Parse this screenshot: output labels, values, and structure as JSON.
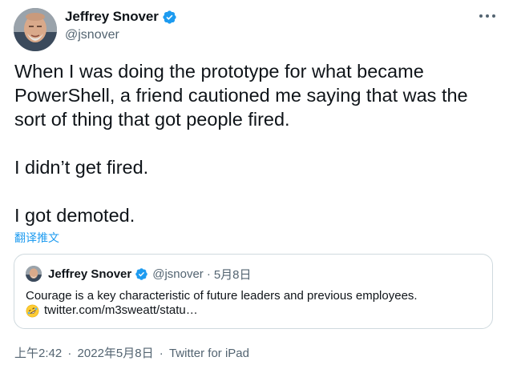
{
  "author": {
    "display_name": "Jeffrey Snover",
    "handle": "@jsnover",
    "verified": true
  },
  "tweet": {
    "paragraphs": [
      "When I was doing the prototype for what became PowerShell, a friend cautioned me saying that was the sort of thing that got people fired.",
      "I didn’t get fired.",
      "I got demoted."
    ],
    "translate_label": "翻译推文"
  },
  "quoted_tweet": {
    "display_name": "Jeffrey Snover",
    "handle": "@jsnover",
    "separator": "·",
    "date": "5月8日",
    "text": "Courage is a key characteristic of future leaders and previous employees.",
    "emoji": "rolling-on-floor-laughing",
    "link": "twitter.com/m3sweatt/statu…"
  },
  "footer": {
    "time": "上午2:42",
    "separator": "·",
    "date": "2022年5月8日",
    "source": "Twitter for iPad"
  },
  "icons": {
    "verified": "verified-badge-icon",
    "more": "more-options-icon"
  },
  "colors": {
    "accent": "#1d9bf0",
    "text": "#0f1419",
    "secondary": "#536471",
    "border": "#cfd9de"
  }
}
